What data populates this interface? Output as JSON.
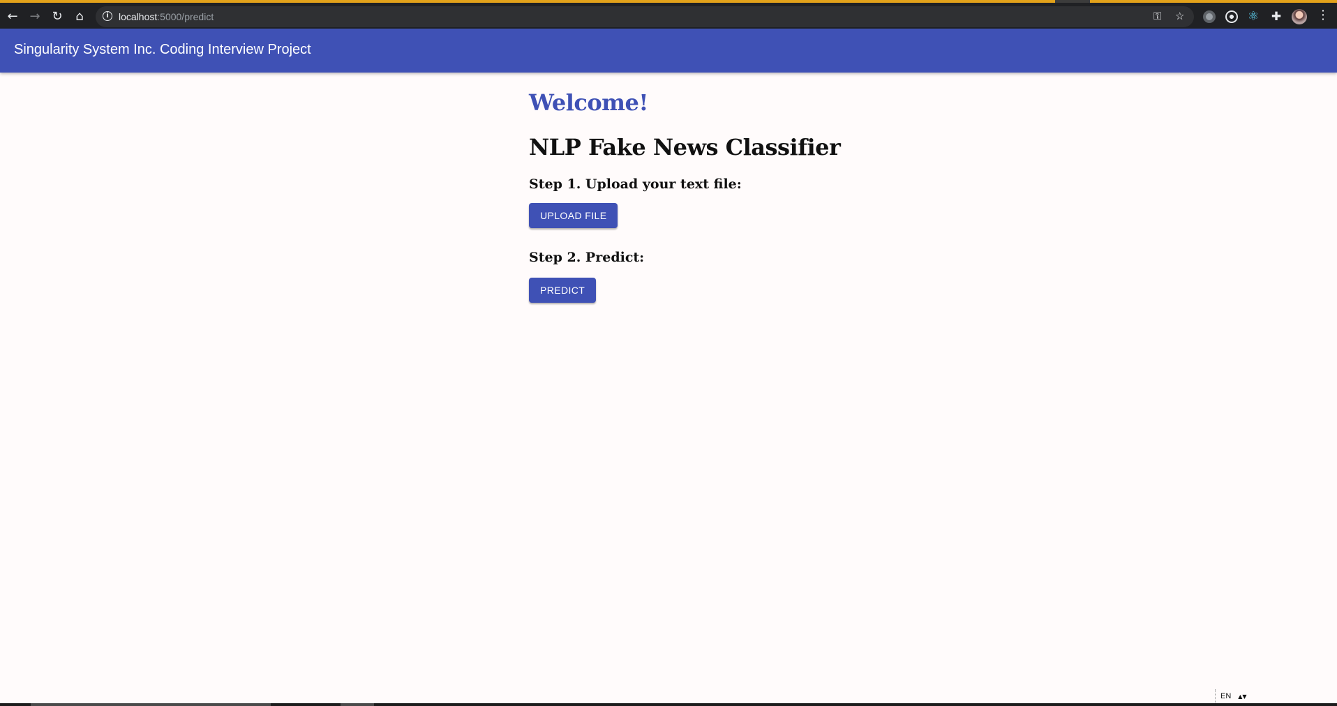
{
  "browser": {
    "url_host": "localhost",
    "url_path": ":5000/predict",
    "back_icon": "arrow-left-icon",
    "forward_icon": "arrow-right-icon",
    "reload_icon": "reload-icon",
    "home_icon": "home-icon",
    "password_icon": "key-icon",
    "bookmark_icon": "star-icon",
    "menu_icon": "vertical-dots-icon"
  },
  "app_bar": {
    "title": "Singularity System Inc. Coding Interview Project",
    "color": "#3f51b5"
  },
  "main": {
    "welcome": "Welcome!",
    "title": "NLP Fake News Classifier",
    "step1_label": "Step 1. Upload your text file:",
    "upload_button": "UPLOAD FILE",
    "step2_label": "Step 2. Predict:",
    "predict_button": "PREDICT"
  },
  "system": {
    "language": "EN"
  },
  "colors": {
    "primary": "#3f51b5",
    "background": "#fffbfb",
    "browser_chrome": "#202124"
  }
}
